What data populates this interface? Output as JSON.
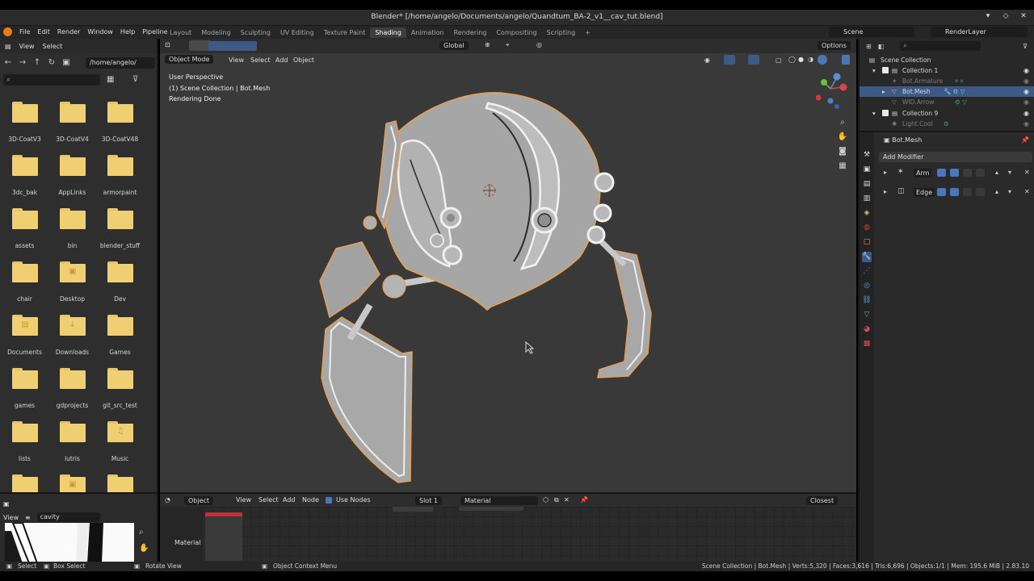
{
  "window": {
    "title": "Blender* [/home/angelo/Documents/angelo/Quandtum_BA-2_v1__cav_tut.blend]"
  },
  "menu": [
    "File",
    "Edit",
    "Render",
    "Window",
    "Help",
    "Pipeline"
  ],
  "workspace_tabs": [
    "Layout",
    "Modeling",
    "Sculpting",
    "UV Editing",
    "Texture Paint",
    "Shading",
    "Animation",
    "Rendering",
    "Compositing",
    "Scripting"
  ],
  "active_workspace": "Shading",
  "scene": "Scene",
  "render_layer": "RenderLayer",
  "file_browser": {
    "menu": [
      "View",
      "Select"
    ],
    "path": "/home/angelo/",
    "folders": [
      {
        "name": "3D-CoatV3",
        "icon": ""
      },
      {
        "name": "3D-CoatV4",
        "icon": ""
      },
      {
        "name": "3D-CoatV48",
        "icon": ""
      },
      {
        "name": "3dc_bak",
        "icon": ""
      },
      {
        "name": "AppLinks",
        "icon": ""
      },
      {
        "name": "armorpaint",
        "icon": ""
      },
      {
        "name": "assets",
        "icon": ""
      },
      {
        "name": "bin",
        "icon": ""
      },
      {
        "name": "blender_stuff",
        "icon": ""
      },
      {
        "name": "chair",
        "icon": ""
      },
      {
        "name": "Desktop",
        "icon": "▣"
      },
      {
        "name": "Dev",
        "icon": ""
      },
      {
        "name": "Documents",
        "icon": "▤"
      },
      {
        "name": "Downloads",
        "icon": "↓"
      },
      {
        "name": "Games",
        "icon": ""
      },
      {
        "name": "games",
        "icon": ""
      },
      {
        "name": "gdprojects",
        "icon": ""
      },
      {
        "name": "git_src_test",
        "icon": ""
      },
      {
        "name": "lists",
        "icon": ""
      },
      {
        "name": "lutris",
        "icon": ""
      },
      {
        "name": "Music",
        "icon": "♫"
      },
      {
        "name": "",
        "icon": ""
      },
      {
        "name": "",
        "icon": "▣"
      },
      {
        "name": "",
        "icon": ""
      }
    ]
  },
  "image_editor": {
    "view": "View",
    "image_name": "cavity"
  },
  "viewport": {
    "mode": "Object Mode",
    "menu": [
      "View",
      "Select",
      "Add",
      "Object"
    ],
    "orientation": "Global",
    "options": "Options",
    "info": [
      "User Perspective",
      "(1) Scene Collection | Bot.Mesh",
      "Rendering Done"
    ]
  },
  "shader_editor": {
    "object": "Object",
    "menu": [
      "View",
      "Select",
      "Add",
      "Node"
    ],
    "use_nodes": "Use Nodes",
    "slot": "Slot 1",
    "material": "Material",
    "snap": "Closest",
    "sidebar_label": "Material"
  },
  "outliner": {
    "rows": [
      {
        "label": "Scene Collection",
        "dim": false,
        "selected": false
      },
      {
        "label": "Collection 1",
        "dim": false,
        "selected": false
      },
      {
        "label": "Bot.Armature",
        "dim": true,
        "selected": false
      },
      {
        "label": "Bot.Mesh",
        "dim": false,
        "selected": true
      },
      {
        "label": "WID.Arrow",
        "dim": true,
        "selected": false
      },
      {
        "label": "Collection 9",
        "dim": false,
        "selected": false
      },
      {
        "label": "Light.Cool",
        "dim": true,
        "selected": false
      }
    ]
  },
  "properties": {
    "object": "Bot.Mesh",
    "add_modifier": "Add Modifier",
    "modifiers": [
      "Arm",
      "Edge"
    ]
  },
  "status_bar": {
    "select": "Select",
    "box_select": "Box Select",
    "rotate_view": "Rotate View",
    "context_menu": "Object Context Menu",
    "stats": "Scene Collection | Bot.Mesh | Verts:5,320 | Faces:3,616 | Tris:6,696 | Objects:1/1 | Mem: 195.6 MiB | 2.83.10"
  },
  "colors": {
    "selection_outline": "#e8a050",
    "mesh": "#a9a9a9",
    "accent_blue": "#4c76b8",
    "folder": "#f0cf72"
  }
}
